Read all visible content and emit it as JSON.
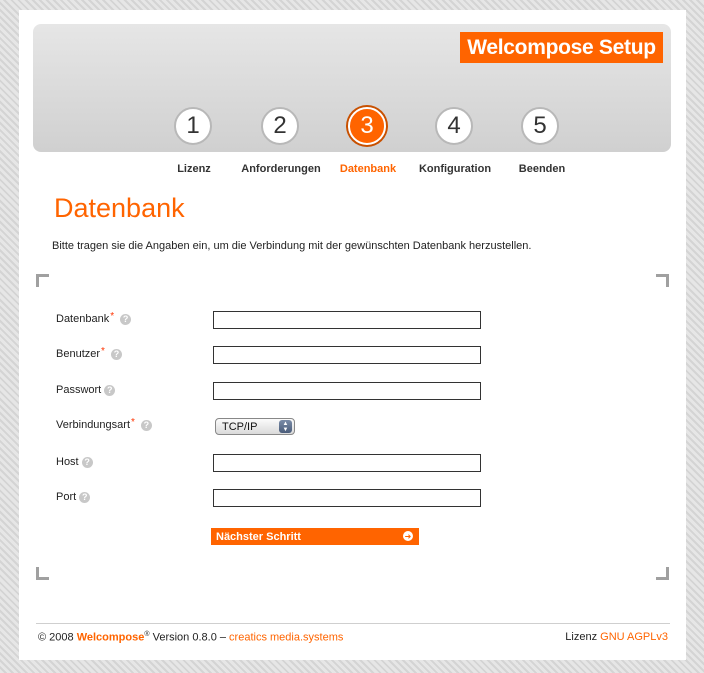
{
  "brand": "Welcompose Setup",
  "steps": [
    {
      "number": "1",
      "label": "Lizenz"
    },
    {
      "number": "2",
      "label": "Anforderungen"
    },
    {
      "number": "3",
      "label": "Datenbank"
    },
    {
      "number": "4",
      "label": "Konfiguration"
    },
    {
      "number": "5",
      "label": "Beenden"
    }
  ],
  "active_step": 3,
  "page_title": "Datenbank",
  "intro": "Bitte tragen sie die Angaben ein, um die Verbindung mit der gewünschten Datenbank herzustellen.",
  "fields": [
    {
      "label": "Datenbank",
      "required": "*",
      "value": ""
    },
    {
      "label": "Benutzer",
      "required": "*",
      "value": ""
    },
    {
      "label": "Passwort",
      "required": "",
      "value": ""
    },
    {
      "label": "Verbindungsart",
      "required": "*",
      "selected": "TCP/IP"
    },
    {
      "label": "Host",
      "required": "",
      "value": ""
    },
    {
      "label": "Port",
      "required": "",
      "value": ""
    }
  ],
  "help_glyph": "?",
  "next_button": "Nächster Schritt",
  "footer": {
    "copyright": "© 2008",
    "product": "Welcompose",
    "registered": "®",
    "version": "Version 0.8.0 –",
    "company": "creatics media.systems",
    "license_label": "Lizenz",
    "license_link": "GNU AGPLv3"
  },
  "colors": {
    "accent": "#ff6400"
  }
}
